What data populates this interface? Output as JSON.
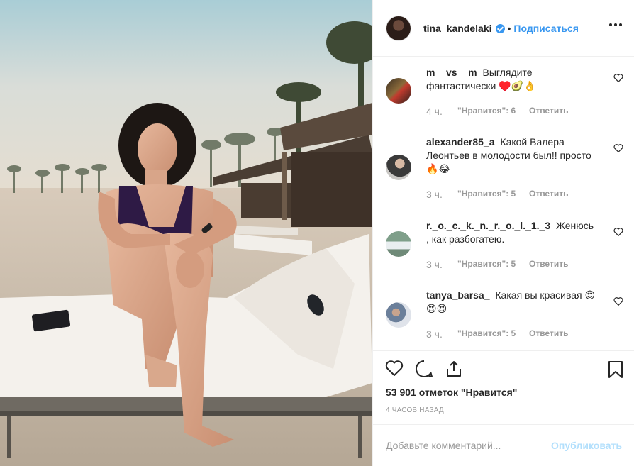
{
  "header": {
    "username": "tina_kandelaki",
    "separator": "•",
    "follow_label": "Подписаться",
    "more_icon": "more-dots-icon",
    "verified_icon": "verified-badge-icon"
  },
  "comments": [
    {
      "username": "m__vs__m",
      "text": "Выглядите фантастически ♥️🥑👌",
      "time": "4 ч.",
      "likes": "\"Нравится\": 6",
      "reply": "Ответить"
    },
    {
      "username": "alexander85_a",
      "text": "Какой Валера Леонтьев в молодости был!! просто 🔥😂",
      "time": "3 ч.",
      "likes": "\"Нравится\": 5",
      "reply": "Ответить"
    },
    {
      "username": "r._o._c._k._n._r._o._l._1._3",
      "text": "Женюсь , как разбогатею.",
      "time": "3 ч.",
      "likes": "\"Нравится\": 5",
      "reply": "Ответить"
    },
    {
      "username": "tanya_barsa_",
      "text": "Какая вы красивая 😍😍😍",
      "time": "3 ч.",
      "likes": "\"Нравится\": 5",
      "reply": "Ответить"
    }
  ],
  "actions": {
    "likes_text": "53 901 отметок \"Нравится\"",
    "time_ago": "4 ЧАСОВ НАЗАД",
    "icons": [
      "heart-icon",
      "comment-icon",
      "share-icon",
      "bookmark-icon"
    ]
  },
  "add_comment": {
    "placeholder": "Добавьте комментарий...",
    "publish_label": "Опубликовать"
  },
  "colors": {
    "accent": "#3897f0",
    "muted": "#999999",
    "publish_disabled": "#b2dffc",
    "text": "#262626"
  }
}
